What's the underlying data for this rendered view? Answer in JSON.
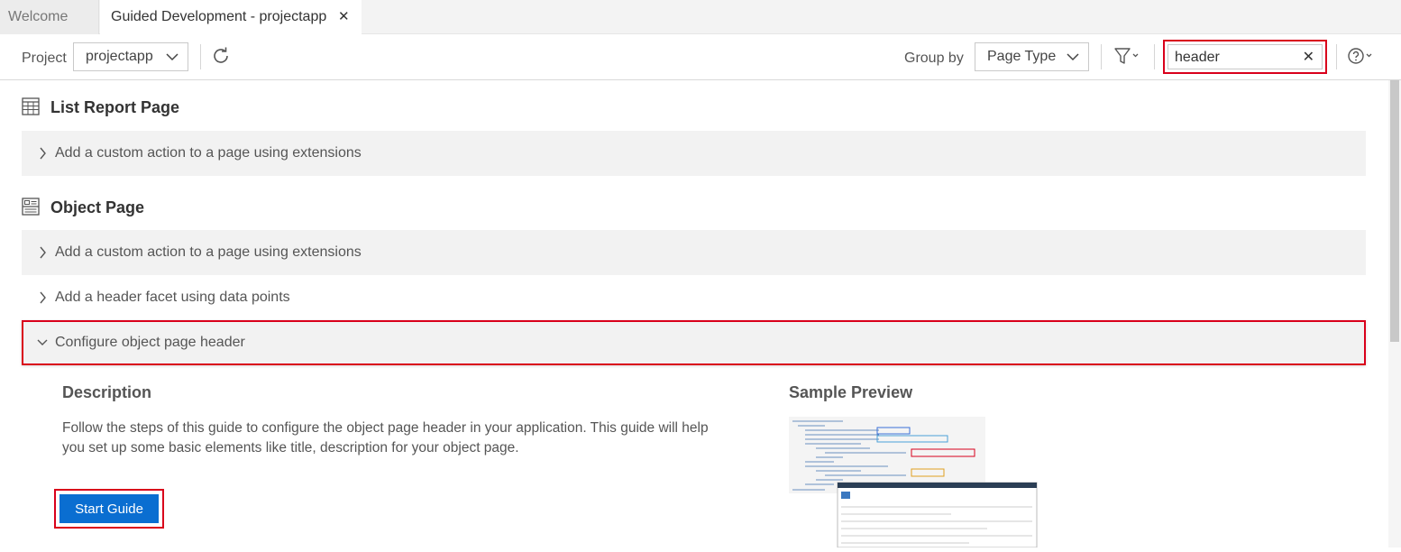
{
  "tabs": [
    {
      "label": "Welcome"
    },
    {
      "label": "Guided Development - projectapp"
    }
  ],
  "toolbar": {
    "project_label": "Project",
    "project_value": "projectapp",
    "group_by_label": "Group by",
    "group_by_value": "Page Type",
    "search_value": "header"
  },
  "sections": [
    {
      "title": "List Report Page",
      "icon": "table-icon",
      "items": [
        {
          "label": "Add a custom action to a page using extensions",
          "expanded": false
        }
      ]
    },
    {
      "title": "Object Page",
      "icon": "object-page-icon",
      "items": [
        {
          "label": "Add a custom action to a page using extensions",
          "expanded": false
        },
        {
          "label": "Add a header facet using data points",
          "expanded": false
        },
        {
          "label": "Configure object page header",
          "expanded": true
        }
      ]
    }
  ],
  "detail": {
    "description_heading": "Description",
    "description_text": "Follow the steps of this guide to configure the object page header in your application. This guide will help you set up some basic elements like title, description for your object page.",
    "start_button": "Start Guide",
    "preview_heading": "Sample Preview"
  },
  "colors": {
    "highlight": "#d9001b",
    "primary_button": "#0a6ed1"
  }
}
